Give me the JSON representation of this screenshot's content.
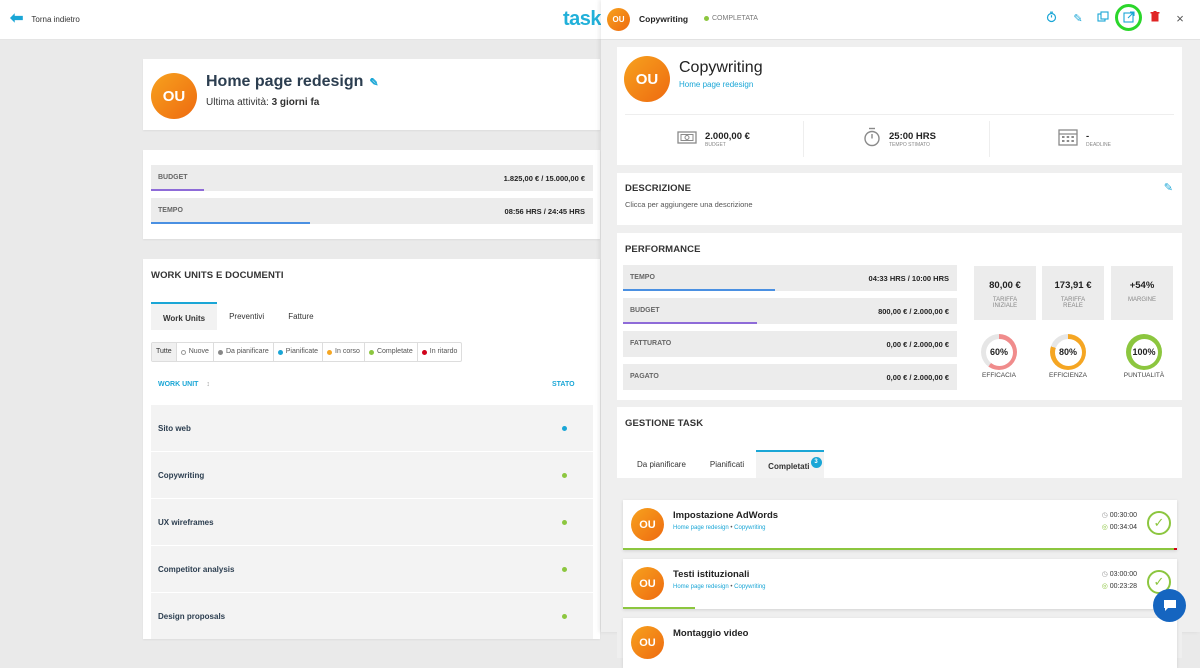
{
  "topbar": {
    "back_label": "Torna indietro",
    "logo_text": "task"
  },
  "project": {
    "avatar": "OU",
    "title": "Home page redesign",
    "activity_prefix": "Ultima attività:",
    "activity_value": "3 giorni fa",
    "budget_label": "BUDGET",
    "budget_value": "1.825,00 € / 15.000,00 €",
    "budget_fraction": 0.12,
    "tempo_label": "TEMPO",
    "tempo_value": "08:56 HRS / 24:45 HRS",
    "tempo_fraction": 0.36
  },
  "work_units": {
    "section_title": "WORK UNITS E DOCUMENTI",
    "tabs": [
      "Work Units",
      "Preventivi",
      "Fatture"
    ],
    "filters": [
      {
        "label": "Tutte",
        "color": ""
      },
      {
        "label": "Nuove",
        "color": "#ffffff"
      },
      {
        "label": "Da pianificare",
        "color": "#888888"
      },
      {
        "label": "Pianificate",
        "color": "#1aa6d6"
      },
      {
        "label": "In corso",
        "color": "#f5a623"
      },
      {
        "label": "Completate",
        "color": "#8cc63f"
      },
      {
        "label": "In ritardo",
        "color": "#d0021b"
      }
    ],
    "col_work_unit": "WORK UNIT",
    "col_sort_icon": "↕",
    "col_stato": "STATO",
    "rows": [
      {
        "name": "Sito web",
        "status_color": "#1aa6d6"
      },
      {
        "name": "Copywriting",
        "status_color": "#8cc63f"
      },
      {
        "name": "UX wireframes",
        "status_color": "#8cc63f"
      },
      {
        "name": "Competitor analysis",
        "status_color": "#8cc63f"
      },
      {
        "name": "Design proposals",
        "status_color": "#8cc63f"
      }
    ]
  },
  "panel": {
    "avatar": "OU",
    "task_name": "Copywriting",
    "status": "COMPLETATA",
    "status_color": "#8cc63f",
    "header_icons": [
      "timer-icon",
      "pencil-icon",
      "copy-icon",
      "external-link-icon",
      "trash-icon",
      "close-icon"
    ],
    "close_symbol": "×",
    "title": "Copywriting",
    "project_link": "Home page redesign",
    "budget_value": "2.000,00 €",
    "budget_sub": "BUDGET",
    "time_value": "25:00 HRS",
    "time_sub": "TEMPO STIMATO",
    "deadline_value": "-",
    "deadline_sub": "DEADLINE",
    "descrizione_title": "DESCRIZIONE",
    "descrizione_hint": "Clicca per aggiungere una descrizione",
    "performance_title": "PERFORMANCE",
    "perf_rows": [
      {
        "label": "TEMPO",
        "value": "04:33 HRS / 10:00 HRS",
        "fraction": 0.455,
        "color": "#4a90e2"
      },
      {
        "label": "BUDGET",
        "value": "800,00 € / 2.000,00 €",
        "fraction": 0.4,
        "color": "#8e6bd8"
      },
      {
        "label": "FATTURATO",
        "value": "0,00 € / 2.000,00 €",
        "fraction": 0,
        "color": "#8cc63f"
      },
      {
        "label": "PAGATO",
        "value": "0,00 € / 2.000,00 €",
        "fraction": 0,
        "color": "#8cc63f"
      }
    ],
    "tiles": [
      {
        "value": "80,00 €",
        "sub1": "TARIFFA",
        "sub2": "INIZIALE"
      },
      {
        "value": "173,91 €",
        "sub1": "TARIFFA",
        "sub2": "REALE"
      },
      {
        "value": "+54%",
        "sub1": "MARGINE",
        "sub2": ""
      }
    ],
    "rings": [
      {
        "value": "60%",
        "label": "EFFICACIA",
        "fraction": 0.6,
        "color": "#f08c8c"
      },
      {
        "value": "80%",
        "label": "EFFICIENZA",
        "fraction": 0.8,
        "color": "#f5a623"
      },
      {
        "value": "100%",
        "label": "PUNTUALITÀ",
        "fraction": 1.0,
        "color": "#8cc63f"
      }
    ],
    "gestione_title": "GESTIONE TASK",
    "task_tabs": [
      "Da pianificare",
      "Pianificati",
      "Completati"
    ],
    "completati_badge": "3",
    "tasks": [
      {
        "avatar": "OU",
        "title": "Impostazione AdWords",
        "project": "Home page redesign",
        "sep": "•",
        "work_unit": "Copywriting",
        "time_est": "00:30:00",
        "time_real": "00:34:04",
        "progress": 1.0
      },
      {
        "avatar": "OU",
        "title": "Testi istituzionali",
        "project": "Home page redesign",
        "sep": "•",
        "work_unit": "Copywriting",
        "time_est": "03:00:00",
        "time_real": "00:23:28",
        "progress": 0.13
      },
      {
        "avatar": "OU",
        "title": "Montaggio video",
        "project": "",
        "sep": "",
        "work_unit": "",
        "time_est": "",
        "time_real": "",
        "progress": 0
      }
    ]
  }
}
